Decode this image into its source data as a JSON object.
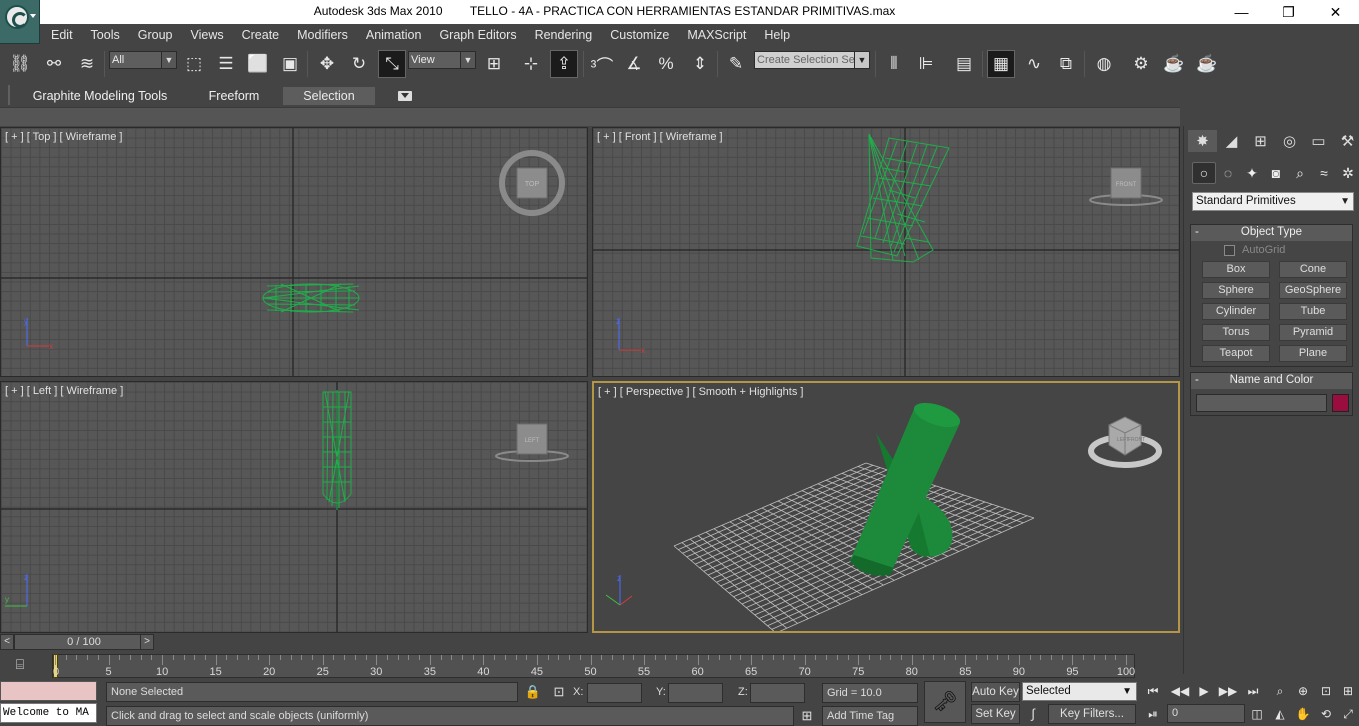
{
  "window": {
    "app_title": "Autodesk 3ds Max  2010",
    "file_title": "TELLO - 4A - PRACTICA CON HERRAMIENTAS ESTANDAR PRIMITIVAS.max",
    "minimize": "—",
    "maximize": "❐",
    "close": "✕"
  },
  "menu": [
    "Edit",
    "Tools",
    "Group",
    "Views",
    "Create",
    "Modifiers",
    "Animation",
    "Graph Editors",
    "Rendering",
    "Customize",
    "MAXScript",
    "Help"
  ],
  "toolbar": {
    "selection_filter": "All",
    "reference_coord": "View",
    "named_selection_placeholder": "Create Selection Se"
  },
  "ribbon": {
    "tabs": [
      "Graphite Modeling Tools",
      "Freeform",
      "Selection"
    ],
    "active_tab": "Selection"
  },
  "viewports": {
    "top": "[ + ] [ Top ] [ Wireframe ]",
    "front": "[ + ] [ Front ] [ Wireframe ]",
    "left": "[ + ] [ Left ] [ Wireframe ]",
    "perspective": "[ + ] [ Perspective ] [ Smooth + Highlights ]",
    "viewcube_top": "TOP",
    "viewcube_front": "FRONT",
    "viewcube_left": "LEFT",
    "viewcube_persp_a": "LEFT",
    "viewcube_persp_b": "FRONT",
    "axis_x": "x",
    "axis_y": "y",
    "axis_z": "z"
  },
  "colors": {
    "object_green": "#1c8a3a",
    "wire_green": "#1fae4a",
    "active_viewport_border": "#b49646",
    "object_color": "#990e3e"
  },
  "command_panel": {
    "category_dropdown": "Standard Primitives",
    "object_type_title": "Object Type",
    "autogrid_label": "AutoGrid",
    "primitives": [
      "Box",
      "Cone",
      "Sphere",
      "GeoSphere",
      "Cylinder",
      "Tube",
      "Torus",
      "Pyramid",
      "Teapot",
      "Plane"
    ],
    "name_color_title": "Name and Color",
    "name_value": ""
  },
  "timeline": {
    "slider_label": "0 / 100",
    "current_frame": 0,
    "total_frames": 100,
    "tick_labels": [
      "0",
      "5",
      "10",
      "15",
      "20",
      "25",
      "30",
      "35",
      "40",
      "45",
      "50",
      "55",
      "60",
      "65",
      "70",
      "75",
      "80",
      "85",
      "90",
      "95",
      "100"
    ]
  },
  "status": {
    "listener_text": "Welcome to MA",
    "selection_status": "None Selected",
    "prompt": "Click and drag to select and scale objects (uniformly)",
    "x_label": "X:",
    "y_label": "Y:",
    "z_label": "Z:",
    "grid": "Grid = 10.0",
    "add_time_tag": "Add Time Tag",
    "auto_key": "Auto Key",
    "set_key": "Set Key",
    "key_filter_selected": "Selected",
    "key_filters": "Key Filters...",
    "current_frame_field": "0"
  }
}
